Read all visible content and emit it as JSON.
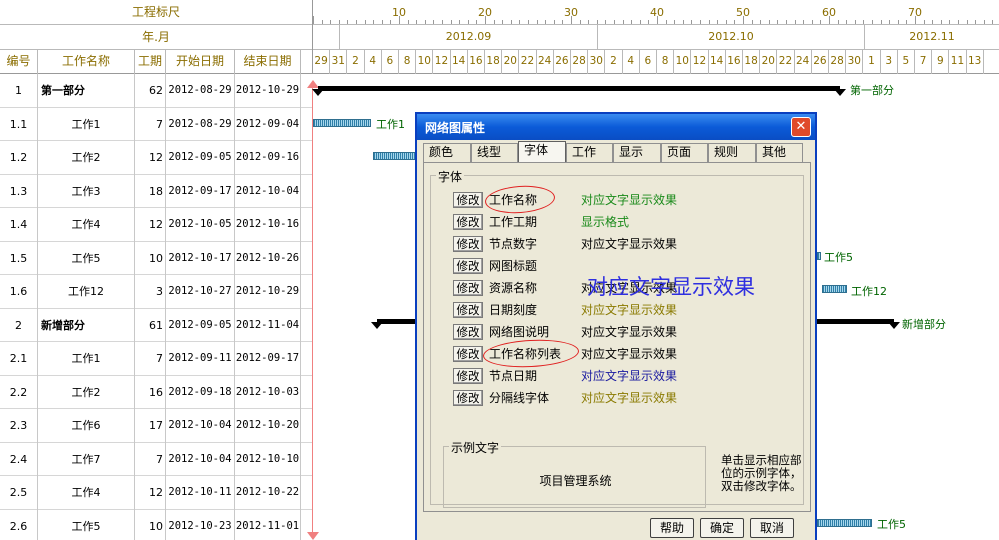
{
  "ruler": {
    "row1_label": "工程标尺",
    "row2_label": "年.月",
    "numbers": [
      "10",
      "20",
      "30",
      "40",
      "50",
      "60",
      "70"
    ],
    "months": [
      "2012.09",
      "2012.10",
      "2012.11"
    ],
    "days": [
      "29",
      "31",
      "2",
      "4",
      "6",
      "8",
      "10",
      "12",
      "14",
      "16",
      "18",
      "20",
      "22",
      "24",
      "26",
      "28",
      "30",
      "2",
      "4",
      "6",
      "8",
      "10",
      "12",
      "14",
      "16",
      "18",
      "20",
      "22",
      "24",
      "26",
      "28",
      "30",
      "1",
      "3",
      "5",
      "7",
      "9",
      "11",
      "13"
    ]
  },
  "table": {
    "headers": [
      "编号",
      "工作名称",
      "工期",
      "开始日期",
      "结束日期"
    ],
    "rows": [
      {
        "id": "1",
        "name": "第一部分",
        "dur": "62",
        "start": "2012-08-29",
        "end": "2012-10-29",
        "summary": true
      },
      {
        "id": "1.1",
        "name": "工作1",
        "dur": "7",
        "start": "2012-08-29",
        "end": "2012-09-04"
      },
      {
        "id": "1.2",
        "name": "工作2",
        "dur": "12",
        "start": "2012-09-05",
        "end": "2012-09-16"
      },
      {
        "id": "1.3",
        "name": "工作3",
        "dur": "18",
        "start": "2012-09-17",
        "end": "2012-10-04"
      },
      {
        "id": "1.4",
        "name": "工作4",
        "dur": "12",
        "start": "2012-10-05",
        "end": "2012-10-16"
      },
      {
        "id": "1.5",
        "name": "工作5",
        "dur": "10",
        "start": "2012-10-17",
        "end": "2012-10-26"
      },
      {
        "id": "1.6",
        "name": "工作12",
        "dur": "3",
        "start": "2012-10-27",
        "end": "2012-10-29"
      },
      {
        "id": "2",
        "name": "新增部分",
        "dur": "61",
        "start": "2012-09-05",
        "end": "2012-11-04",
        "summary": true
      },
      {
        "id": "2.1",
        "name": "工作1",
        "dur": "7",
        "start": "2012-09-11",
        "end": "2012-09-17"
      },
      {
        "id": "2.2",
        "name": "工作2",
        "dur": "16",
        "start": "2012-09-18",
        "end": "2012-10-03"
      },
      {
        "id": "2.3",
        "name": "工作6",
        "dur": "17",
        "start": "2012-10-04",
        "end": "2012-10-20"
      },
      {
        "id": "2.4",
        "name": "工作7",
        "dur": "7",
        "start": "2012-10-04",
        "end": "2012-10-10"
      },
      {
        "id": "2.5",
        "name": "工作4",
        "dur": "12",
        "start": "2012-10-11",
        "end": "2012-10-22"
      },
      {
        "id": "2.6",
        "name": "工作5",
        "dur": "10",
        "start": "2012-10-23",
        "end": "2012-11-01"
      }
    ]
  },
  "gantt_labels": {
    "part1": "第一部分",
    "w1": "工作1",
    "w5": "工作5",
    "w12": "工作12",
    "part2": "新增部分",
    "w5b": "工作5"
  },
  "dialog": {
    "title": "网络图属性",
    "close": "✕",
    "tabs": [
      "颜色",
      "线型",
      "字体",
      "工作",
      "显示",
      "页面",
      "规则",
      "其他"
    ],
    "active_tab": "字体",
    "group_title": "字体",
    "modify_label": "修改",
    "fonts": [
      {
        "name": "工作名称",
        "sample": "对应文字显示效果",
        "color": "#1a8a1a"
      },
      {
        "name": "工作工期",
        "sample": "显示格式",
        "color": "#1a8a1a"
      },
      {
        "name": "节点数字",
        "sample": "对应文字显示效果",
        "color": "#000000"
      },
      {
        "name": "网图标题",
        "sample": "",
        "color": "#000000"
      },
      {
        "name": "资源名称",
        "sample": "对应文字显示效果",
        "color": "#000000"
      },
      {
        "name": "日期刻度",
        "sample": "对应文字显示效果",
        "color": "#8a7a00"
      },
      {
        "name": "网络图说明",
        "sample": "对应文字显示效果",
        "color": "#000000"
      },
      {
        "name": "工作名称列表",
        "sample": "对应文字显示效果",
        "color": "#000000"
      },
      {
        "name": "节点日期",
        "sample": "对应文字显示效果",
        "color": "#1a1aa0"
      },
      {
        "name": "分隔线字体",
        "sample": "对应文字显示效果",
        "color": "#8a7a00"
      }
    ],
    "big_sample": "对应文字显示效果",
    "example_title": "示例文字",
    "example_text": "项目管理系统",
    "hint": "单击显示相应部位的示例字体，双击修改字体。",
    "buttons": [
      "帮助",
      "确定",
      "取消"
    ]
  }
}
